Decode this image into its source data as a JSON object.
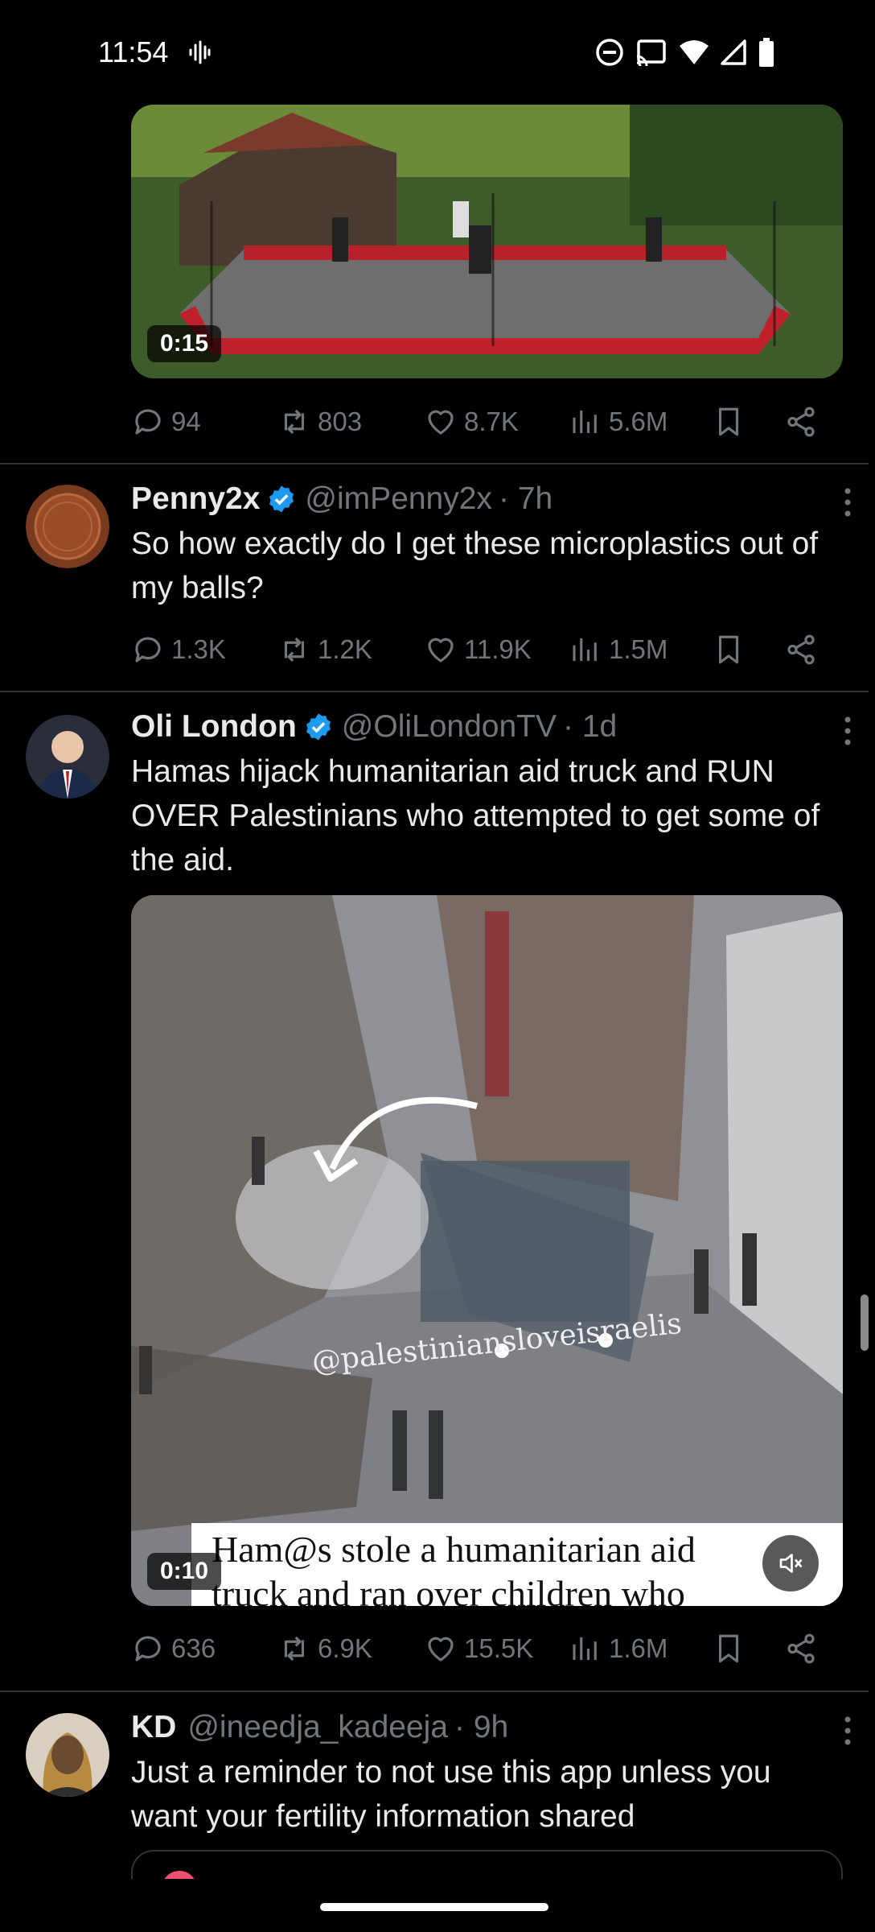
{
  "status_bar": {
    "time": "11:54"
  },
  "tweets": [
    {
      "media": {
        "duration": "0:15"
      },
      "actions": {
        "replies": "94",
        "reposts": "803",
        "likes": "8.7K",
        "views": "5.6M"
      }
    },
    {
      "author": {
        "name": "Penny2x",
        "verified": true,
        "handle": "@imPenny2x",
        "time": "· 7h"
      },
      "text": "So how exactly do I get these microplastics out of my balls?",
      "actions": {
        "replies": "1.3K",
        "reposts": "1.2K",
        "likes": "11.9K",
        "views": "1.5M"
      }
    },
    {
      "author": {
        "name": "Oli London",
        "verified": true,
        "handle": "@OliLondonTV",
        "time": "· 1d"
      },
      "text": "Hamas hijack humanitarian aid truck and RUN OVER Palestinians who attempted to get some of the aid.",
      "media": {
        "duration": "0:10",
        "watermark": "@palestiniansloveisraelis",
        "caption_line1": "Ham@s stole a humanitarian aid",
        "caption_line2": "truck and ran over children who"
      },
      "actions": {
        "replies": "636",
        "reposts": "6.9K",
        "likes": "15.5K",
        "views": "1.6M"
      }
    },
    {
      "author": {
        "name": "KD",
        "verified": false,
        "handle": "@ineedja_kadeeja",
        "time": "· 9h"
      },
      "text": "Just a reminder to not use this app unless you want your fertility information shared"
    }
  ],
  "colors": {
    "background": "#000000",
    "text": "#e7e9ea",
    "secondary": "#71767b",
    "verified": "#1d9bf0",
    "divider": "#2f3336"
  }
}
